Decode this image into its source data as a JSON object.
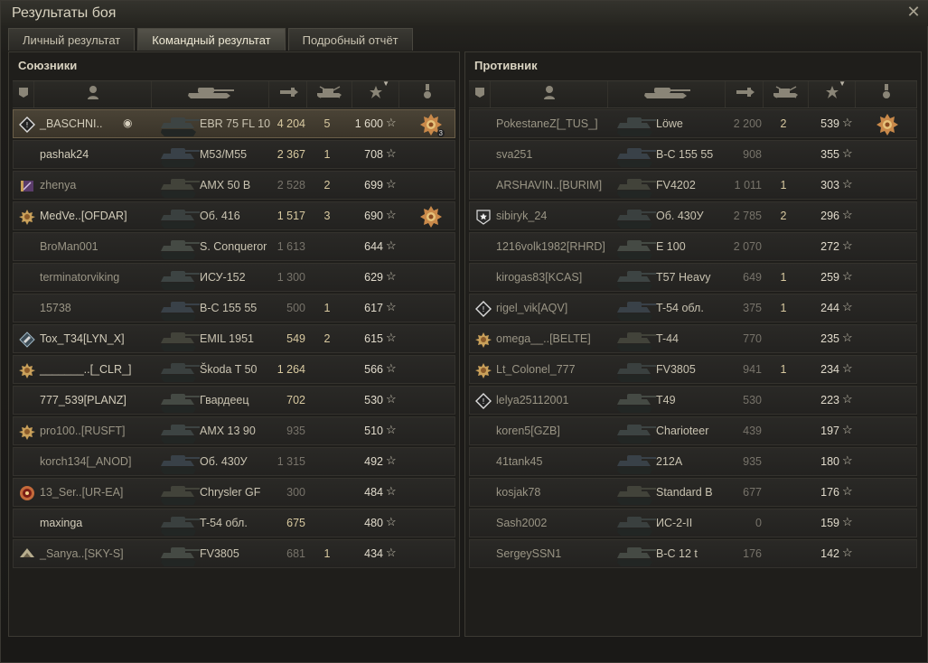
{
  "window": {
    "title": "Результаты боя"
  },
  "tabs": [
    {
      "label": "Личный результат",
      "active": false
    },
    {
      "label": "Командный результат",
      "active": true
    },
    {
      "label": "Подробный отчёт",
      "active": false
    }
  ],
  "allies": {
    "title": "Союзники",
    "rows": [
      {
        "medal": "medal-white",
        "name": "_BASCHNI..",
        "tank": "EBR 75 FL 10",
        "damage": "4 204",
        "dmg_hi": true,
        "kills": "5",
        "xp": "1 600",
        "me": true,
        "award": "ace-award-3",
        "award_count": "3"
      },
      {
        "medal": "",
        "name": "pashak24",
        "tank": "M53/M55",
        "damage": "2 367",
        "dmg_hi": true,
        "kills": "1",
        "xp": "708"
      },
      {
        "medal": "clan-purple",
        "name": "zhenya",
        "tank": "AMX 50 B",
        "damage": "2 528",
        "dmg_hi": false,
        "kills": "2",
        "xp": "699",
        "dim": true
      },
      {
        "medal": "medal-gold",
        "name": "MedVe..[OFDAR]",
        "tank": "Об. 416",
        "damage": "1 517",
        "dmg_hi": true,
        "kills": "3",
        "xp": "690",
        "award": "ace-award"
      },
      {
        "medal": "",
        "name": "BroMan001",
        "tank": "S. Conqueror",
        "damage": "1 613",
        "dmg_hi": false,
        "kills": "",
        "xp": "644",
        "dim": true
      },
      {
        "medal": "",
        "name": "terminatorviking",
        "tank": "ИСУ-152",
        "damage": "1 300",
        "dmg_hi": false,
        "kills": "",
        "xp": "629",
        "dim": true
      },
      {
        "medal": "",
        "name": "15738",
        "tank": "B-C 155 55",
        "damage": "500",
        "dmg_hi": false,
        "kills": "1",
        "xp": "617",
        "dim": true
      },
      {
        "medal": "medal-flag",
        "name": "Tox_T34[LYN_X]",
        "tank": "EMIL 1951",
        "damage": "549",
        "dmg_hi": true,
        "kills": "2",
        "xp": "615"
      },
      {
        "medal": "medal-gold",
        "name": "_______..[_CLR_]",
        "tank": "Škoda T 50",
        "damage": "1 264",
        "dmg_hi": true,
        "kills": "",
        "xp": "566"
      },
      {
        "medal": "",
        "name": "777_539[PLANZ]",
        "tank": "Гвардеец",
        "damage": "702",
        "dmg_hi": true,
        "kills": "",
        "xp": "530"
      },
      {
        "medal": "medal-gold",
        "name": "pro100..[RUSFT]",
        "tank": "AMX 13 90",
        "damage": "935",
        "dmg_hi": false,
        "kills": "",
        "xp": "510",
        "dim": true
      },
      {
        "medal": "",
        "name": "korch134[_ANOD]",
        "tank": "Об. 430У",
        "damage": "1 315",
        "dmg_hi": false,
        "kills": "",
        "xp": "492",
        "dim": true
      },
      {
        "medal": "medal-red",
        "name": "13_Ser..[UR-EA]",
        "tank": "Chrysler GF",
        "damage": "300",
        "dmg_hi": false,
        "kills": "",
        "xp": "484",
        "dim": true
      },
      {
        "medal": "",
        "name": "maxinga",
        "tank": "T-54 обл.",
        "damage": "675",
        "dmg_hi": true,
        "kills": "",
        "xp": "480"
      },
      {
        "medal": "medal-silver",
        "name": "_Sanya..[SKY-S]",
        "tank": "FV3805",
        "damage": "681",
        "dmg_hi": false,
        "kills": "1",
        "xp": "434",
        "dim": true
      }
    ]
  },
  "enemies": {
    "title": "Противник",
    "rows": [
      {
        "medal": "",
        "name": "PokestaneZ[_TUS_]",
        "tank": "Löwe",
        "damage": "2 200",
        "dmg_hi": false,
        "kills": "2",
        "xp": "539",
        "dim": true,
        "award": "ace-award"
      },
      {
        "medal": "",
        "name": "sva251",
        "tank": "B-C 155 55",
        "damage": "908",
        "dmg_hi": false,
        "kills": "",
        "xp": "355",
        "dim": true
      },
      {
        "medal": "",
        "name": "ARSHAVIN..[BURIM]",
        "tank": "FV4202",
        "damage": "1 011",
        "dmg_hi": false,
        "kills": "1",
        "xp": "303",
        "dim": true
      },
      {
        "medal": "medal-star",
        "name": "sibiryk_24",
        "tank": "Об. 430У",
        "damage": "2 785",
        "dmg_hi": false,
        "kills": "2",
        "xp": "296",
        "dim": true
      },
      {
        "medal": "",
        "name": "1216volk1982[RHRD]",
        "tank": "E 100",
        "damage": "2 070",
        "dmg_hi": false,
        "kills": "",
        "xp": "272",
        "dim": true
      },
      {
        "medal": "",
        "name": "kirogas83[KCAS]",
        "tank": "T57 Heavy",
        "damage": "649",
        "dmg_hi": false,
        "kills": "1",
        "xp": "259",
        "dim": true
      },
      {
        "medal": "medal-white",
        "name": "rigel_vik[AQV]",
        "tank": "T-54 обл.",
        "damage": "375",
        "dmg_hi": false,
        "kills": "1",
        "xp": "244",
        "dim": true
      },
      {
        "medal": "medal-gold",
        "name": "omega__..[BELTE]",
        "tank": "T-44",
        "damage": "770",
        "dmg_hi": false,
        "kills": "",
        "xp": "235",
        "dim": true
      },
      {
        "medal": "medal-gold",
        "name": "Lt_Colonel_777",
        "tank": "FV3805",
        "damage": "941",
        "dmg_hi": false,
        "kills": "1",
        "xp": "234",
        "dim": true
      },
      {
        "medal": "medal-white",
        "name": "lelya25112001",
        "tank": "T49",
        "damage": "530",
        "dmg_hi": false,
        "kills": "",
        "xp": "223",
        "dim": true
      },
      {
        "medal": "",
        "name": "koren5[GZB]",
        "tank": "Charioteer",
        "damage": "439",
        "dmg_hi": false,
        "kills": "",
        "xp": "197",
        "dim": true
      },
      {
        "medal": "",
        "name": "41tank45",
        "tank": "212A",
        "damage": "935",
        "dmg_hi": false,
        "kills": "",
        "xp": "180",
        "dim": true
      },
      {
        "medal": "",
        "name": "kosjak78",
        "tank": "Standard B",
        "damage": "677",
        "dmg_hi": false,
        "kills": "",
        "xp": "176",
        "dim": true
      },
      {
        "medal": "",
        "name": "Sash2002",
        "tank": "ИС-2-II",
        "damage": "0",
        "dmg_hi": false,
        "kills": "",
        "xp": "159",
        "dim": true
      },
      {
        "medal": "",
        "name": "SergeySSN1",
        "tank": "B-C 12 t",
        "damage": "176",
        "dmg_hi": false,
        "kills": "",
        "xp": "142",
        "dim": true
      }
    ]
  },
  "columns": [
    {
      "icon": "squad-icon"
    },
    {
      "icon": "player-icon"
    },
    {
      "icon": "tank-icon"
    },
    {
      "icon": "damage-icon"
    },
    {
      "icon": "kills-icon"
    },
    {
      "icon": "xp-star-icon"
    },
    {
      "icon": "award-icon"
    }
  ],
  "colors": {
    "background": "#1f1e1b",
    "highlight_row": "#4a4336",
    "damage_high": "#d8c9a0",
    "damage_low": "#77736a"
  }
}
